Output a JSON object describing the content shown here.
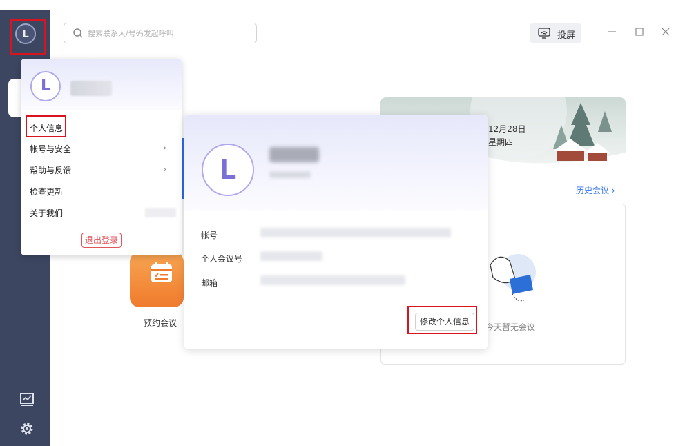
{
  "search": {
    "placeholder": "搜索联系人/号码发起呼叫"
  },
  "header": {
    "cast_label": "投屏"
  },
  "banner": {
    "date": "12月28日",
    "weekday": "星期四"
  },
  "history": {
    "label": "历史会议"
  },
  "meetings": {
    "empty_text": "今天暂无会议"
  },
  "actions": {
    "book_label": "预约会议"
  },
  "user_menu": {
    "items": [
      {
        "label": "个人信息"
      },
      {
        "label": "帐号与安全",
        "has_submenu": true
      },
      {
        "label": "帮助与反馈",
        "has_submenu": true
      },
      {
        "label": "检查更新"
      },
      {
        "label": "关于我们"
      }
    ],
    "logout_label": "退出登录"
  },
  "profile_card": {
    "fields": [
      {
        "label": "帐号"
      },
      {
        "label": "个人会议号"
      },
      {
        "label": "邮箱"
      }
    ],
    "edit_label": "修改个人信息"
  },
  "avatar_letter": "L",
  "colors": {
    "sidebar": "#3c4660",
    "accent": "#2e6ff2",
    "highlight": "#d9141f",
    "logout": "#e0565d",
    "avatar_ring": "#7b6fd8"
  }
}
